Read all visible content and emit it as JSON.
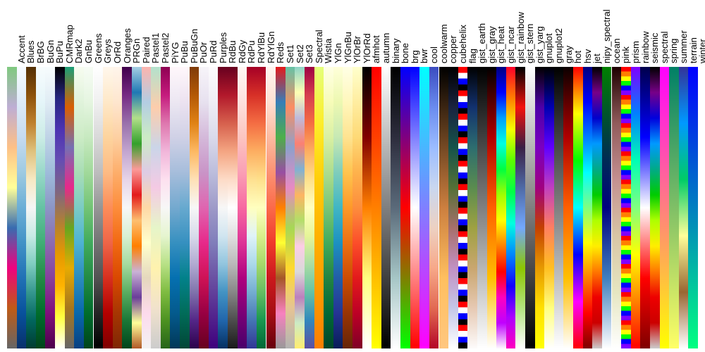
{
  "chart_data": {
    "type": "heatmap",
    "title": "",
    "xlabel": "",
    "ylabel": "",
    "description": "Matplotlib colormap reference — vertical bars showing each named colormap gradient",
    "colormaps": [
      {
        "name": "Accent",
        "stops": [
          "#7fc97f",
          "#beaed4",
          "#fdc086",
          "#ffff99",
          "#386cb0",
          "#f0027f",
          "#bf5b17",
          "#666666"
        ]
      },
      {
        "name": "Blues",
        "stops": [
          "#f7fbff",
          "#deebf7",
          "#c6dbef",
          "#9ecae1",
          "#6baed6",
          "#4292c6",
          "#2171b5",
          "#08519c",
          "#08306b"
        ]
      },
      {
        "name": "BrBG",
        "stops": [
          "#543005",
          "#8c510a",
          "#bf812d",
          "#dfc27d",
          "#f6e8c3",
          "#f5f5f5",
          "#c7eae5",
          "#80cdc1",
          "#35978f",
          "#01665e",
          "#003c30"
        ]
      },
      {
        "name": "BuGn",
        "stops": [
          "#f7fcfd",
          "#e5f5f9",
          "#ccece6",
          "#99d8c9",
          "#66c2a4",
          "#41ae76",
          "#238b45",
          "#006d2c",
          "#00441b"
        ]
      },
      {
        "name": "BuPu",
        "stops": [
          "#f7fcfd",
          "#e0ecf4",
          "#bfd3e6",
          "#9ebcda",
          "#8c96c6",
          "#8c6bb1",
          "#88419d",
          "#810f7c",
          "#4d004b"
        ]
      },
      {
        "name": "CMRmap",
        "stops": [
          "#000000",
          "#26267f",
          "#4d33b2",
          "#664db2",
          "#806680",
          "#b28033",
          "#e59900",
          "#ffb300",
          "#ffff40",
          "#ffffff"
        ]
      },
      {
        "name": "Dark2",
        "stops": [
          "#1b9e77",
          "#d95f02",
          "#7570b3",
          "#e7298a",
          "#66a61e",
          "#e6ab02",
          "#a6761d",
          "#666666"
        ]
      },
      {
        "name": "GnBu",
        "stops": [
          "#f7fcf0",
          "#e0f3db",
          "#ccebc5",
          "#a8ddb5",
          "#7bccc4",
          "#4eb3d3",
          "#2b8cbe",
          "#0868ac",
          "#084081"
        ]
      },
      {
        "name": "Greens",
        "stops": [
          "#f7fcf5",
          "#e5f5e0",
          "#c7e9c0",
          "#a1d99b",
          "#74c476",
          "#41ab5d",
          "#238b45",
          "#006d2c",
          "#00441b"
        ]
      },
      {
        "name": "Greys",
        "stops": [
          "#ffffff",
          "#f0f0f0",
          "#d9d9d9",
          "#bdbdbd",
          "#969696",
          "#737373",
          "#525252",
          "#252525",
          "#000000"
        ]
      },
      {
        "name": "OrRd",
        "stops": [
          "#fff7ec",
          "#fee8c8",
          "#fdd49e",
          "#fdbb84",
          "#fc8d59",
          "#ef6548",
          "#d7301f",
          "#b30000",
          "#7f0000"
        ]
      },
      {
        "name": "Oranges",
        "stops": [
          "#fff5eb",
          "#fee6ce",
          "#fdd0a2",
          "#fdae6b",
          "#fd8d3c",
          "#f16913",
          "#d94801",
          "#a63603",
          "#7f2704"
        ]
      },
      {
        "name": "PRGn",
        "stops": [
          "#40004b",
          "#762a83",
          "#9970ab",
          "#c2a5cf",
          "#e7d4e8",
          "#f7f7f7",
          "#d9f0d3",
          "#a6dba0",
          "#5aae61",
          "#1b7837",
          "#00441b"
        ]
      },
      {
        "name": "Paired",
        "stops": [
          "#a6cee3",
          "#1f78b4",
          "#b2df8a",
          "#33a02c",
          "#fb9a99",
          "#e31a1c",
          "#fdbf6f",
          "#ff7f00",
          "#cab2d6",
          "#6a3d9a",
          "#ffff99",
          "#b15928"
        ]
      },
      {
        "name": "Pastel1",
        "stops": [
          "#fbb4ae",
          "#b3cde3",
          "#ccebc5",
          "#decbe4",
          "#fed9a6",
          "#ffffcc",
          "#e5d8bd",
          "#fddaec",
          "#f2f2f2"
        ]
      },
      {
        "name": "Pastel2",
        "stops": [
          "#b3e2cd",
          "#fdcdac",
          "#cbd5e8",
          "#f4cae4",
          "#e6f5c9",
          "#fff2ae",
          "#f1e2cc",
          "#cccccc"
        ]
      },
      {
        "name": "PiYG",
        "stops": [
          "#8e0152",
          "#c51b7d",
          "#de77ae",
          "#f1b6da",
          "#fde0ef",
          "#f7f7f7",
          "#e6f5d0",
          "#b8e186",
          "#7fbc41",
          "#4d9221",
          "#276419"
        ]
      },
      {
        "name": "PuBu",
        "stops": [
          "#fff7fb",
          "#ece7f2",
          "#d0d1e6",
          "#a6bddb",
          "#74a9cf",
          "#3690c0",
          "#0570b0",
          "#045a8d",
          "#023858"
        ]
      },
      {
        "name": "PuBuGn",
        "stops": [
          "#fff7fb",
          "#ece2f0",
          "#d0d1e6",
          "#a6bddb",
          "#67a9cf",
          "#3690c0",
          "#02818a",
          "#016c59",
          "#014636"
        ]
      },
      {
        "name": "PuOr",
        "stops": [
          "#7f3b08",
          "#b35806",
          "#e08214",
          "#fdb863",
          "#fee0b6",
          "#f7f7f7",
          "#d8daeb",
          "#b2abd2",
          "#8073ac",
          "#542788",
          "#2d004b"
        ]
      },
      {
        "name": "PuRd",
        "stops": [
          "#f7f4f9",
          "#e7e1ef",
          "#d4b9da",
          "#c994c7",
          "#df65b0",
          "#e7298a",
          "#ce1256",
          "#980043",
          "#67001f"
        ]
      },
      {
        "name": "Purples",
        "stops": [
          "#fcfbfd",
          "#efedf5",
          "#dadaeb",
          "#bcbddc",
          "#9e9ac8",
          "#807dba",
          "#6a51a3",
          "#54278f",
          "#3f007d"
        ]
      },
      {
        "name": "RdBu",
        "stops": [
          "#67001f",
          "#b2182b",
          "#d6604d",
          "#f4a582",
          "#fddbc7",
          "#f7f7f7",
          "#d1e5f0",
          "#92c5de",
          "#4393c3",
          "#2166ac",
          "#053061"
        ]
      },
      {
        "name": "RdGy",
        "stops": [
          "#67001f",
          "#b2182b",
          "#d6604d",
          "#f4a582",
          "#fddbc7",
          "#ffffff",
          "#e0e0e0",
          "#bababa",
          "#878787",
          "#4d4d4d",
          "#1a1a1a"
        ]
      },
      {
        "name": "RdPu",
        "stops": [
          "#fff7f3",
          "#fde0dd",
          "#fcc5c0",
          "#fa9fb5",
          "#f768a1",
          "#dd3497",
          "#ae017e",
          "#7a0177",
          "#49006a"
        ]
      },
      {
        "name": "RdYlBu",
        "stops": [
          "#a50026",
          "#d73027",
          "#f46d43",
          "#fdae61",
          "#fee090",
          "#ffffbf",
          "#e0f3f8",
          "#abd9e9",
          "#74add1",
          "#4575b4",
          "#313695"
        ]
      },
      {
        "name": "RdYlGn",
        "stops": [
          "#a50026",
          "#d73027",
          "#f46d43",
          "#fdae61",
          "#fee08b",
          "#ffffbf",
          "#d9ef8b",
          "#a6d96a",
          "#66bd63",
          "#1a9850",
          "#006837"
        ]
      },
      {
        "name": "Reds",
        "stops": [
          "#fff5f0",
          "#fee0d2",
          "#fcbba1",
          "#fc9272",
          "#fb6a4a",
          "#ef3b2c",
          "#cb181d",
          "#a50f15",
          "#67000d"
        ]
      },
      {
        "name": "Set1",
        "stops": [
          "#e41a1c",
          "#377eb8",
          "#4daf4a",
          "#984ea3",
          "#ff7f00",
          "#ffff33",
          "#a65628",
          "#f781bf",
          "#999999"
        ]
      },
      {
        "name": "Set2",
        "stops": [
          "#66c2a5",
          "#fc8d62",
          "#8da0cb",
          "#e78ac3",
          "#a6d854",
          "#ffd92f",
          "#e5c494",
          "#b3b3b3"
        ]
      },
      {
        "name": "Set3",
        "stops": [
          "#8dd3c7",
          "#ffffb3",
          "#bebada",
          "#fb8072",
          "#80b1d3",
          "#fdb462",
          "#b3de69",
          "#fccde5",
          "#d9d9d9",
          "#bc80bd",
          "#ccebc5",
          "#ffed6f"
        ]
      },
      {
        "name": "Spectral",
        "stops": [
          "#9e0142",
          "#d53e4f",
          "#f46d43",
          "#fdae61",
          "#fee08b",
          "#ffffbf",
          "#e6f598",
          "#abdda4",
          "#66c2a5",
          "#3288bd",
          "#5e4fa2"
        ]
      },
      {
        "name": "Wistia",
        "stops": [
          "#e4ff7a",
          "#fded2a",
          "#ffce0a",
          "#ffb100",
          "#fe9900",
          "#fc7f00"
        ]
      },
      {
        "name": "YlGn",
        "stops": [
          "#ffffe5",
          "#f7fcb9",
          "#d9f0a3",
          "#addd8e",
          "#78c679",
          "#41ab5d",
          "#238443",
          "#006837",
          "#004529"
        ]
      },
      {
        "name": "YlGnBu",
        "stops": [
          "#ffffd9",
          "#edf8b1",
          "#c7e9b4",
          "#7fcdbb",
          "#41b6c4",
          "#1d91c0",
          "#225ea8",
          "#253494",
          "#081d58"
        ]
      },
      {
        "name": "YlOrBr",
        "stops": [
          "#ffffe5",
          "#fff7bc",
          "#fee391",
          "#fec44f",
          "#fe9929",
          "#ec7014",
          "#cc4c02",
          "#993404",
          "#662506"
        ]
      },
      {
        "name": "YlOrRd",
        "stops": [
          "#ffffcc",
          "#ffeda0",
          "#fed976",
          "#feb24c",
          "#fd8d3c",
          "#fc4e2a",
          "#e31a1c",
          "#bd0026",
          "#800026"
        ]
      },
      {
        "name": "afmhot",
        "stops": [
          "#000000",
          "#800000",
          "#ff7f00",
          "#ffff7f",
          "#ffffff"
        ]
      },
      {
        "name": "autumn",
        "stops": [
          "#ff0000",
          "#ff7f00",
          "#ffff00"
        ]
      },
      {
        "name": "binary",
        "stops": [
          "#ffffff",
          "#000000"
        ]
      },
      {
        "name": "bone",
        "stops": [
          "#000000",
          "#2d2d3d",
          "#5a6a7a",
          "#a6c6c6",
          "#ffffff"
        ]
      },
      {
        "name": "brg",
        "stops": [
          "#0000ff",
          "#ff0000",
          "#00ff00"
        ]
      },
      {
        "name": "bwr",
        "stops": [
          "#0000ff",
          "#ffffff",
          "#ff0000"
        ]
      },
      {
        "name": "cool",
        "stops": [
          "#00ffff",
          "#ff00ff"
        ]
      },
      {
        "name": "coolwarm",
        "stops": [
          "#3b4cc0",
          "#6a8bef",
          "#9bbcff",
          "#c9d7f0",
          "#edd1c2",
          "#f7a889",
          "#e26952",
          "#b40426"
        ]
      },
      {
        "name": "copper",
        "stops": [
          "#000000",
          "#66401f",
          "#cc7f3f",
          "#ffbf5f",
          "#ffc77f"
        ]
      },
      {
        "name": "cubehelix",
        "stops": [
          "#000000",
          "#1a2340",
          "#15534a",
          "#547036",
          "#a66f6b",
          "#c191c2",
          "#c4c7e8",
          "#ffffff"
        ]
      },
      {
        "name": "flag",
        "cycle": [
          "#ff0000",
          "#ffffff",
          "#0000ff",
          "#000000"
        ],
        "repeats": 12
      },
      {
        "name": "gist_earth",
        "stops": [
          "#000000",
          "#12316e",
          "#2d6d6f",
          "#5a8c4f",
          "#9ea142",
          "#c9a66f",
          "#e6c9b3",
          "#fdfbfb"
        ]
      },
      {
        "name": "gist_gray",
        "stops": [
          "#000000",
          "#ffffff"
        ]
      },
      {
        "name": "gist_heat",
        "stops": [
          "#000000",
          "#b00000",
          "#ff5f00",
          "#ffbf00",
          "#ffffff"
        ]
      },
      {
        "name": "gist_ncar",
        "stops": [
          "#000080",
          "#0000ff",
          "#00a0ff",
          "#00ffe0",
          "#00ff40",
          "#a0ff00",
          "#ffff00",
          "#ff8000",
          "#ff0000",
          "#ff00c0",
          "#c000ff",
          "#fef8fe"
        ]
      },
      {
        "name": "gist_rainbow",
        "stops": [
          "#ff0029",
          "#ff7f00",
          "#f5ff00",
          "#5aff00",
          "#00ff47",
          "#00ffe0",
          "#0085ff",
          "#1400ff",
          "#ad00ff",
          "#ff00bf"
        ]
      },
      {
        "name": "gist_stern",
        "stops": [
          "#000000",
          "#f4120c",
          "#3a2045",
          "#4f6aa6",
          "#73a8ff",
          "#8cc600",
          "#b3e580",
          "#ffffff"
        ]
      },
      {
        "name": "gist_yarg",
        "stops": [
          "#ffffff",
          "#000000"
        ]
      },
      {
        "name": "gnuplot",
        "stops": [
          "#000000",
          "#4d00a8",
          "#7a00c0",
          "#a00080",
          "#c44000",
          "#e69900",
          "#ffe000",
          "#ffff00"
        ]
      },
      {
        "name": "gnuplot2",
        "stops": [
          "#000000",
          "#0000b0",
          "#6000ff",
          "#c03fbf",
          "#ff7f60",
          "#ffbf20",
          "#ffff80",
          "#ffffff"
        ]
      },
      {
        "name": "gray",
        "stops": [
          "#000000",
          "#ffffff"
        ]
      },
      {
        "name": "hot",
        "stops": [
          "#0b0000",
          "#b00000",
          "#ff5f00",
          "#ffbf00",
          "#ffffff"
        ]
      },
      {
        "name": "hsv",
        "stops": [
          "#ff0000",
          "#ffff00",
          "#00ff00",
          "#00ffff",
          "#0000ff",
          "#ff00ff",
          "#ff0000"
        ]
      },
      {
        "name": "jet",
        "stops": [
          "#00007f",
          "#0000ff",
          "#007fff",
          "#00ffff",
          "#7fff7f",
          "#ffff00",
          "#ff7f00",
          "#ff0000",
          "#7f0000"
        ]
      },
      {
        "name": "nipy_spectral",
        "stops": [
          "#000000",
          "#770088",
          "#0000cc",
          "#0099ff",
          "#00aa88",
          "#00cc00",
          "#aeff00",
          "#ffee00",
          "#ff7700",
          "#ee0000",
          "#cc0000",
          "#cccccc"
        ]
      },
      {
        "name": "ocean",
        "stops": [
          "#008000",
          "#003f40",
          "#000080",
          "#3f7fbf",
          "#ffffff"
        ]
      },
      {
        "name": "pink",
        "stops": [
          "#1e0000",
          "#915b5b",
          "#c49090",
          "#d8c5a5",
          "#e6e6c1",
          "#ffffff"
        ]
      },
      {
        "name": "prism",
        "cycle": [
          "#ff0000",
          "#ff7f00",
          "#ffff00",
          "#00ff00",
          "#0000ff",
          "#8000ff"
        ],
        "repeats": 10
      },
      {
        "name": "rainbow",
        "stops": [
          "#8000ff",
          "#0080ff",
          "#00ffb4",
          "#80ff80",
          "#ffff00",
          "#ff8000",
          "#ff0000"
        ]
      },
      {
        "name": "seismic",
        "stops": [
          "#00004c",
          "#0000ff",
          "#ffffff",
          "#ff0000",
          "#7f0000"
        ]
      },
      {
        "name": "spectral",
        "stops": [
          "#000000",
          "#770088",
          "#0000dd",
          "#0099ff",
          "#00aa88",
          "#00cc00",
          "#aeff00",
          "#ffee00",
          "#ff7700",
          "#ee0000",
          "#cc0000",
          "#cccccc"
        ]
      },
      {
        "name": "spring",
        "stops": [
          "#ff00ff",
          "#ffff00"
        ]
      },
      {
        "name": "summer",
        "stops": [
          "#008066",
          "#ffff66"
        ]
      },
      {
        "name": "terrain",
        "stops": [
          "#333399",
          "#0099ff",
          "#00cc66",
          "#ffff99",
          "#996633",
          "#ffffff"
        ]
      },
      {
        "name": "winter",
        "stops": [
          "#0000ff",
          "#00ff80"
        ]
      }
    ]
  }
}
